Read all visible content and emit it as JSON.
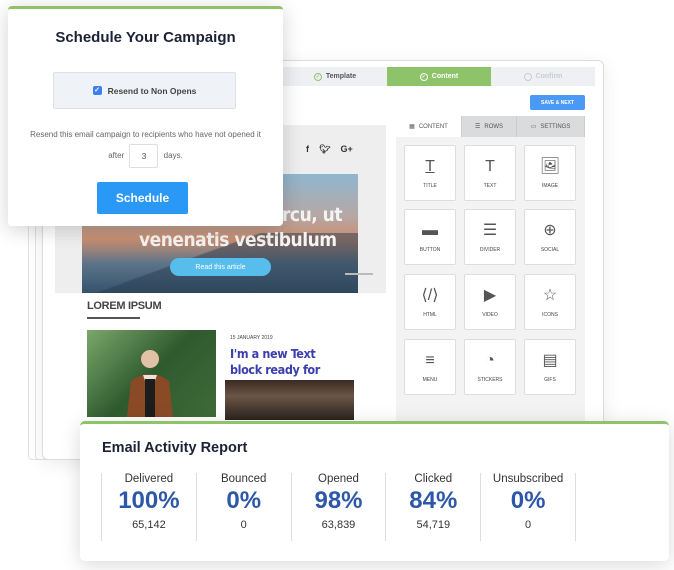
{
  "builder": {
    "steps": [
      {
        "label": "Template",
        "state": "done"
      },
      {
        "label": "Content",
        "state": "active"
      },
      {
        "label": "Confirm",
        "state": "pending"
      }
    ],
    "save_next": "SAVE & NEXT",
    "panel_tabs": [
      {
        "label": "CONTENT",
        "icon": "grid-icon"
      },
      {
        "label": "ROWS",
        "icon": "rows-icon"
      },
      {
        "label": "SETTINGS",
        "icon": "settings-icon"
      }
    ],
    "tiles": [
      {
        "label": "TITLE",
        "icon": "title-icon"
      },
      {
        "label": "TEXT",
        "icon": "text-icon"
      },
      {
        "label": "IMAGE",
        "icon": "image-icon"
      },
      {
        "label": "BUTTON",
        "icon": "button-icon"
      },
      {
        "label": "DIVIDER",
        "icon": "divider-icon"
      },
      {
        "label": "SOCIAL",
        "icon": "social-icon"
      },
      {
        "label": "HTML",
        "icon": "html-icon"
      },
      {
        "label": "VIDEO",
        "icon": "video-icon"
      },
      {
        "label": "ICONS",
        "icon": "star-icon"
      },
      {
        "label": "MENU",
        "icon": "menu-icon"
      },
      {
        "label": "STICKERS",
        "icon": "sticker-icon"
      },
      {
        "label": "GIFS",
        "icon": "gif-icon"
      }
    ],
    "email": {
      "social": [
        "f",
        "t",
        "G+"
      ],
      "hero_line1": "rcu, ut",
      "hero_line2": "venenatis vestibulum",
      "read_button": "Read this article",
      "section_title": "LOREM IPSUM",
      "date": "15 JANUARY 2019",
      "headline": "I'm a new Text block ready for your content."
    }
  },
  "modal": {
    "title": "Schedule Your Campaign",
    "checkbox_label": "Resend to Non Opens",
    "checked": true,
    "desc_before": "Resend this email campaign to recipients who have not opened it after",
    "days_value": "3",
    "desc_after": "days.",
    "button": "Schedule"
  },
  "report": {
    "title": "Email Activity Report",
    "stats": [
      {
        "label": "Delivered",
        "percent": "100%",
        "count": "65,142"
      },
      {
        "label": "Bounced",
        "percent": "0%",
        "count": "0"
      },
      {
        "label": "Opened",
        "percent": "98%",
        "count": "63,839"
      },
      {
        "label": "Clicked",
        "percent": "84%",
        "count": "54,719"
      },
      {
        "label": "Unsubscribed",
        "percent": "0%",
        "count": "0"
      }
    ]
  },
  "colors": {
    "accent_green": "#8fc36a",
    "primary_blue": "#2a99f5",
    "stat_blue": "#2d57a8"
  }
}
